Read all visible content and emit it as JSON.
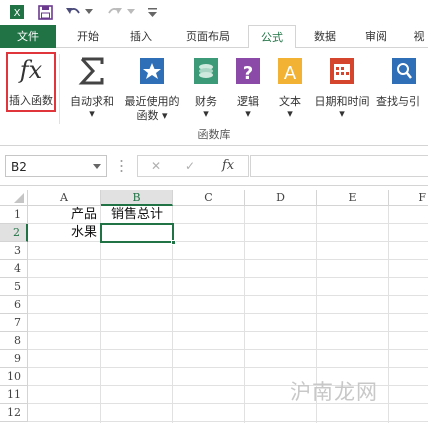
{
  "quick_access": {
    "icons": [
      "excel-icon",
      "save-icon",
      "undo-icon",
      "redo-icon",
      "customize-icon"
    ]
  },
  "tabs": [
    {
      "label": "文件"
    },
    {
      "label": "开始"
    },
    {
      "label": "插入"
    },
    {
      "label": "页面布局"
    },
    {
      "label": "公式"
    },
    {
      "label": "数据"
    },
    {
      "label": "审阅"
    },
    {
      "label": "视"
    }
  ],
  "active_tab": "公式",
  "ribbon": {
    "fx_symbol": "fx",
    "buttons": [
      {
        "line1": "插入函数",
        "line2": ""
      },
      {
        "line1": "自动求和",
        "line2": "▾"
      },
      {
        "line1": "最近使用的",
        "line2": "函数 ▾"
      },
      {
        "line1": "财务",
        "line2": "▾"
      },
      {
        "line1": "逻辑",
        "line2": "▾"
      },
      {
        "line1": "文本",
        "line2": "▾"
      },
      {
        "line1": "日期和时间",
        "line2": "▾"
      },
      {
        "line1": "查找与引",
        "line2": ""
      }
    ],
    "group_label": "函数库",
    "highlight_color": "#e0353a"
  },
  "formula_bar": {
    "name_box": "B2",
    "cancel": "✕",
    "enter": "✓",
    "fx": "fx",
    "formula": ""
  },
  "sheet": {
    "columns": [
      "A",
      "B",
      "C",
      "D",
      "E",
      "F"
    ],
    "rows": [
      "1",
      "2",
      "3",
      "4",
      "5",
      "6",
      "7",
      "8",
      "9",
      "10",
      "11",
      "12"
    ],
    "active_cell": "B2",
    "cells": {
      "A1": "产品",
      "B1": "销售总计",
      "A2": "水果"
    },
    "accent": "#217346"
  },
  "watermark": "沪南龙网"
}
